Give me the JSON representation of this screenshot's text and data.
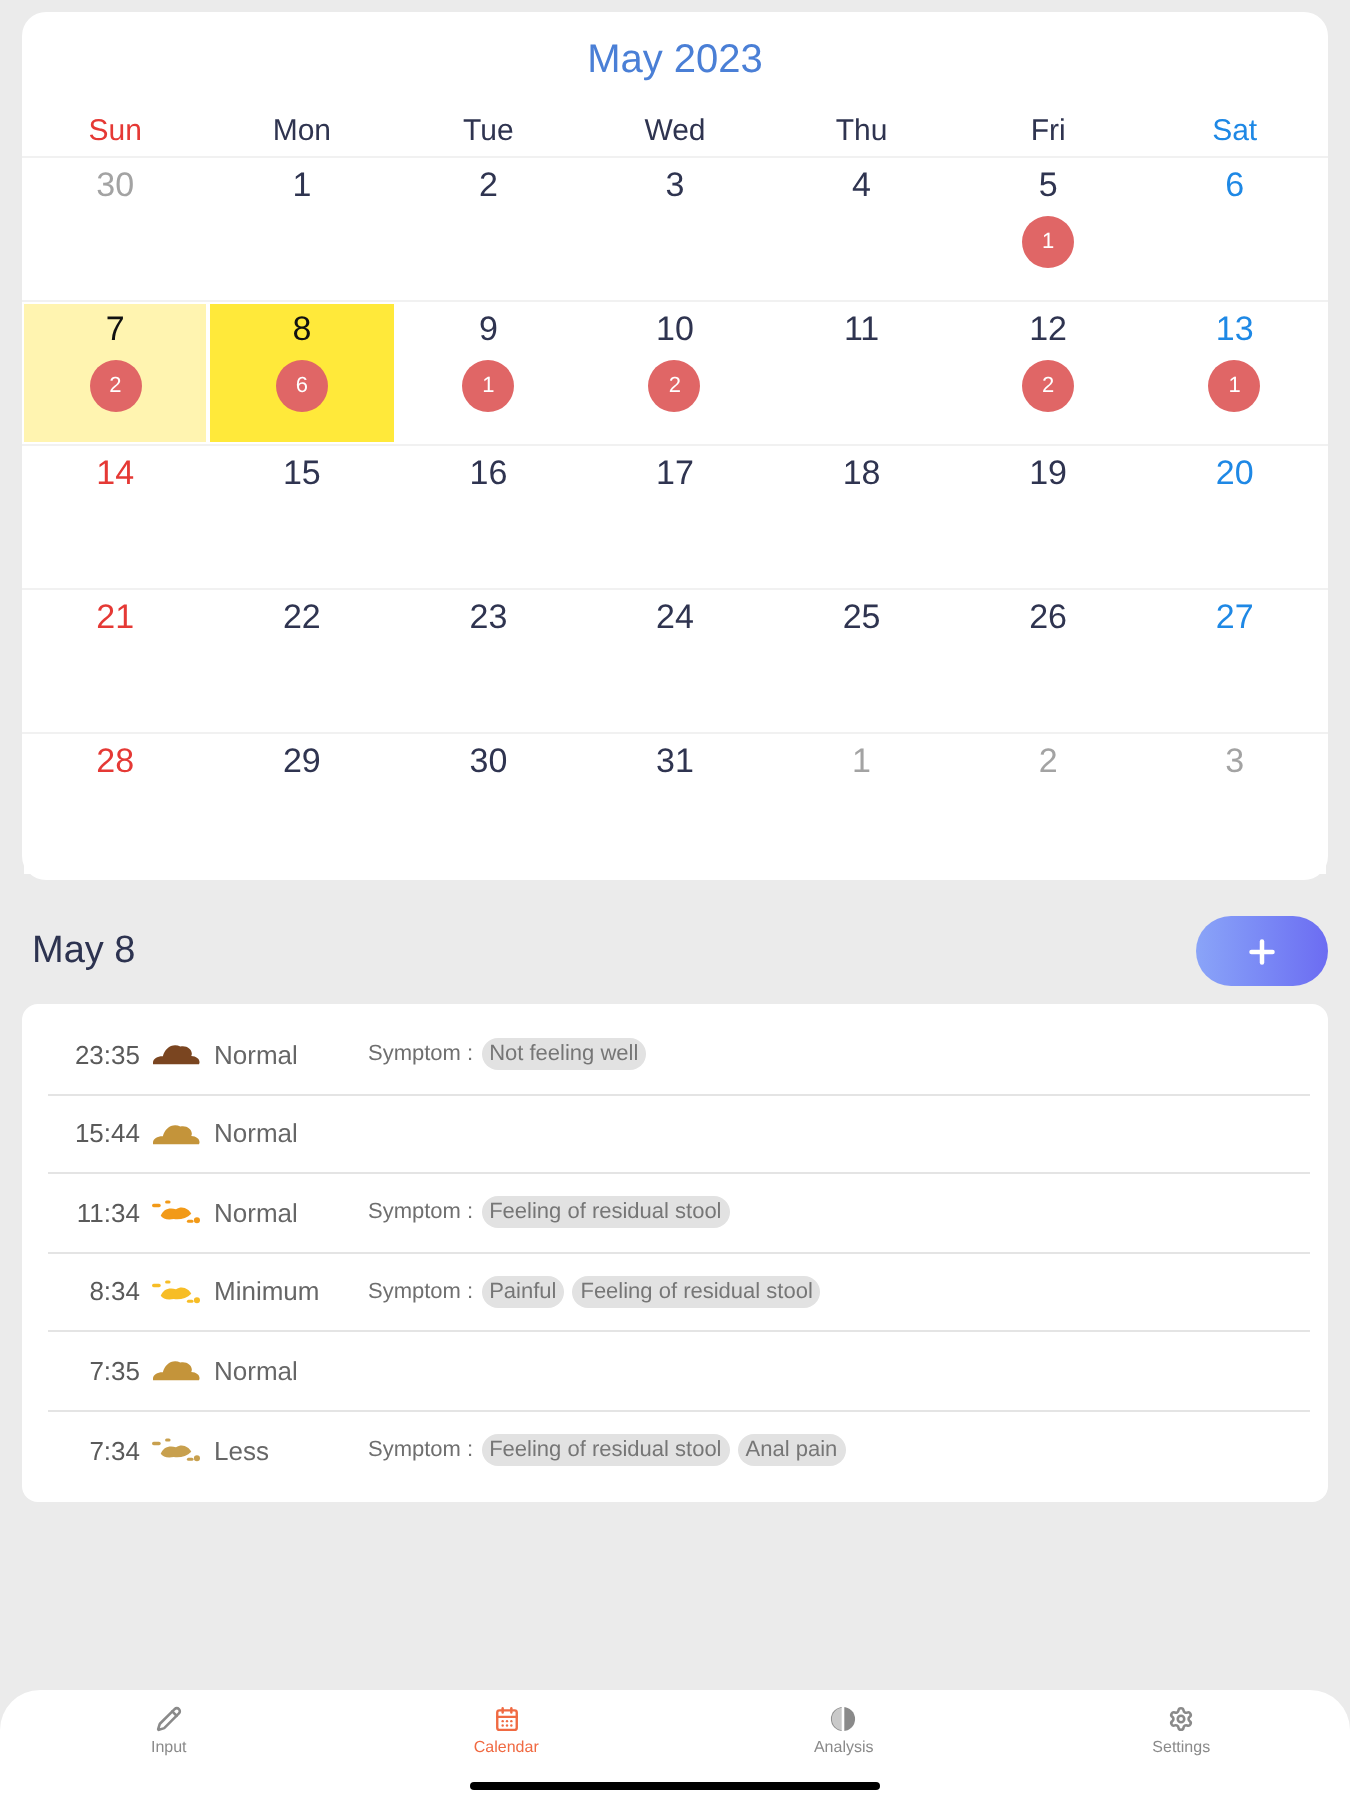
{
  "calendar": {
    "title": "May 2023",
    "weekdays": [
      {
        "label": "Sun",
        "color": "#e53935"
      },
      {
        "label": "Mon",
        "color": "#2f3450"
      },
      {
        "label": "Tue",
        "color": "#2f3450"
      },
      {
        "label": "Wed",
        "color": "#2f3450"
      },
      {
        "label": "Thu",
        "color": "#2f3450"
      },
      {
        "label": "Fri",
        "color": "#2f3450"
      },
      {
        "label": "Sat",
        "color": "#1e88e5"
      }
    ],
    "weeks": [
      [
        {
          "label": "30",
          "in_month": false,
          "selected": false,
          "today": false
        },
        {
          "label": "1",
          "in_month": true,
          "selected": false,
          "today": false
        },
        {
          "label": "2",
          "in_month": true,
          "selected": false,
          "today": false
        },
        {
          "label": "3",
          "in_month": true,
          "selected": false,
          "today": false
        },
        {
          "label": "4",
          "in_month": true,
          "selected": false,
          "today": false
        },
        {
          "label": "5",
          "in_month": true,
          "selected": false,
          "today": false,
          "count": "1"
        },
        {
          "label": "6",
          "in_month": true,
          "selected": false,
          "today": false
        }
      ],
      [
        {
          "label": "7",
          "in_month": true,
          "selected": false,
          "today": true,
          "count": "2"
        },
        {
          "label": "8",
          "in_month": true,
          "selected": true,
          "today": false,
          "count": "6"
        },
        {
          "label": "9",
          "in_month": true,
          "selected": false,
          "today": false,
          "count": "1"
        },
        {
          "label": "10",
          "in_month": true,
          "selected": false,
          "today": false,
          "count": "2"
        },
        {
          "label": "11",
          "in_month": true,
          "selected": false,
          "today": false
        },
        {
          "label": "12",
          "in_month": true,
          "selected": false,
          "today": false,
          "count": "2"
        },
        {
          "label": "13",
          "in_month": true,
          "selected": false,
          "today": false,
          "count": "1"
        }
      ],
      [
        {
          "label": "14",
          "in_month": true,
          "selected": false,
          "today": false
        },
        {
          "label": "15",
          "in_month": true,
          "selected": false,
          "today": false
        },
        {
          "label": "16",
          "in_month": true,
          "selected": false,
          "today": false
        },
        {
          "label": "17",
          "in_month": true,
          "selected": false,
          "today": false
        },
        {
          "label": "18",
          "in_month": true,
          "selected": false,
          "today": false
        },
        {
          "label": "19",
          "in_month": true,
          "selected": false,
          "today": false
        },
        {
          "label": "20",
          "in_month": true,
          "selected": false,
          "today": false
        }
      ],
      [
        {
          "label": "21",
          "in_month": true,
          "selected": false,
          "today": false
        },
        {
          "label": "22",
          "in_month": true,
          "selected": false,
          "today": false
        },
        {
          "label": "23",
          "in_month": true,
          "selected": false,
          "today": false
        },
        {
          "label": "24",
          "in_month": true,
          "selected": false,
          "today": false
        },
        {
          "label": "25",
          "in_month": true,
          "selected": false,
          "today": false
        },
        {
          "label": "26",
          "in_month": true,
          "selected": false,
          "today": false
        },
        {
          "label": "27",
          "in_month": true,
          "selected": false,
          "today": false
        }
      ],
      [
        {
          "label": "28",
          "in_month": true,
          "selected": false,
          "today": false
        },
        {
          "label": "29",
          "in_month": true,
          "selected": false,
          "today": false
        },
        {
          "label": "30",
          "in_month": true,
          "selected": false,
          "today": false
        },
        {
          "label": "31",
          "in_month": true,
          "selected": false,
          "today": false
        },
        {
          "label": "1",
          "in_month": false,
          "selected": false,
          "today": false
        },
        {
          "label": "2",
          "in_month": false,
          "selected": false,
          "today": false
        },
        {
          "label": "3",
          "in_month": false,
          "selected": false,
          "today": false
        }
      ]
    ]
  },
  "day_detail": {
    "title": "May 8",
    "entries": [
      {
        "time": "23:35",
        "kind": "pile",
        "color": "#7a4520",
        "amount": "Normal",
        "symptom_label": "Symptom :",
        "symptoms": [
          "Not feeling well"
        ]
      },
      {
        "time": "15:44",
        "kind": "pile",
        "color": "#c4943a",
        "amount": "Normal"
      },
      {
        "time": "11:34",
        "kind": "splash",
        "color": "#f29a18",
        "amount": "Normal",
        "symptom_label": "Symptom :",
        "symptoms": [
          "Feeling of residual stool"
        ]
      },
      {
        "time": "8:34",
        "kind": "splash",
        "color": "#f7bd26",
        "amount": "Minimum",
        "symptom_label": "Symptom :",
        "symptoms": [
          "Painful",
          "Feeling of residual stool"
        ]
      },
      {
        "time": "7:35",
        "kind": "pile",
        "color": "#c4943a",
        "amount": "Normal"
      },
      {
        "time": "7:34",
        "kind": "splash",
        "color": "#c8a04e",
        "amount": "Less",
        "symptom_label": "Symptom :",
        "symptoms": [
          "Feeling of residual stool",
          "Anal pain"
        ]
      }
    ]
  },
  "tab_bar": {
    "tabs": [
      {
        "label": "Input",
        "selected": false
      },
      {
        "label": "Calendar",
        "selected": true
      },
      {
        "label": "Analysis",
        "selected": false
      },
      {
        "label": "Settings",
        "selected": false
      }
    ]
  }
}
